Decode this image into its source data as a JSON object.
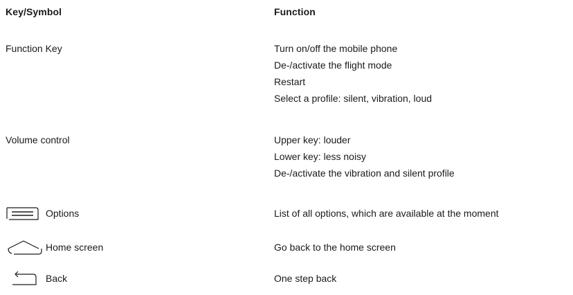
{
  "header": {
    "key_label": "Key/Symbol",
    "function_label": "Function"
  },
  "rows": [
    {
      "key": "Function Key",
      "icon": "",
      "functions": [
        "Turn on/off the mobile phone",
        "De-/activate the flight mode",
        "Restart",
        "Select a profile: silent, vibration, loud"
      ]
    },
    {
      "key": "Volume control",
      "icon": "",
      "functions": [
        "Upper key: louder",
        "Lower key: less noisy",
        "De-/activate the vibration and silent profile"
      ]
    },
    {
      "key": "Options",
      "icon": "menu-icon",
      "functions": [
        "List of all options, which are available at the moment"
      ]
    },
    {
      "key": "Home screen",
      "icon": "home-icon",
      "functions": [
        "Go back to the home screen"
      ]
    },
    {
      "key": "Back",
      "icon": "back-icon",
      "functions": [
        "One step back"
      ]
    }
  ]
}
